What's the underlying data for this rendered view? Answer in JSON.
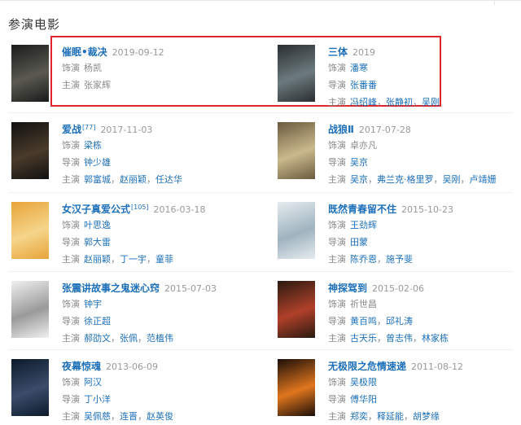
{
  "section": {
    "title": "参演电影"
  },
  "movies": [
    {
      "title": "催眠•裁决",
      "sup": "",
      "date": "2019-09-12",
      "rows": [
        {
          "label": "饰演",
          "values": [
            "杨凯"
          ],
          "linked": false
        },
        {
          "label": "主演",
          "values": [
            "张家辉"
          ],
          "linked": false
        }
      ],
      "poster_colors": [
        "#1a1a1a",
        "#5a5a52"
      ]
    },
    {
      "title": "三体",
      "sup": "",
      "date": "2019",
      "rows": [
        {
          "label": "饰演",
          "values": [
            "潘寒"
          ],
          "linked": true
        },
        {
          "label": "导演",
          "values": [
            "张番番"
          ],
          "linked": true
        },
        {
          "label": "主演",
          "values": [
            "冯绍峰",
            "张静初",
            "吴刚"
          ],
          "linked": true
        }
      ],
      "poster_colors": [
        "#2a2e30",
        "#6c7a7e"
      ]
    },
    {
      "title": "爱战",
      "sup": "[77]",
      "date": "2017-11-03",
      "rows": [
        {
          "label": "饰演",
          "values": [
            "梁栋"
          ],
          "linked": true
        },
        {
          "label": "导演",
          "values": [
            "钟少雄"
          ],
          "linked": true
        },
        {
          "label": "主演",
          "values": [
            "郭富城",
            "赵丽颖",
            "任达华"
          ],
          "linked": true
        }
      ],
      "poster_colors": [
        "#111111",
        "#4a3b2a"
      ]
    },
    {
      "title": "战狼Ⅱ",
      "sup": "",
      "date": "2017-07-28",
      "rows": [
        {
          "label": "饰演",
          "values": [
            "卓亦凡"
          ],
          "linked": false
        },
        {
          "label": "导演",
          "values": [
            "吴京"
          ],
          "linked": true
        },
        {
          "label": "主演",
          "values": [
            "吴京",
            "弗兰克·格里罗",
            "吴刚",
            "卢靖姗"
          ],
          "linked": true
        }
      ],
      "poster_colors": [
        "#6b5a3e",
        "#c9b98c"
      ]
    },
    {
      "title": "女汉子真爱公式",
      "sup": "[105]",
      "date": "2016-03-18",
      "rows": [
        {
          "label": "饰演",
          "values": [
            "叶思逸"
          ],
          "linked": true
        },
        {
          "label": "导演",
          "values": [
            "郭大雷"
          ],
          "linked": true
        },
        {
          "label": "主演",
          "values": [
            "赵丽颖",
            "丁一宇",
            "童菲"
          ],
          "linked": true
        }
      ],
      "poster_colors": [
        "#e8a33a",
        "#f5d58a"
      ]
    },
    {
      "title": "既然青春留不住",
      "sup": "",
      "date": "2015-10-23",
      "rows": [
        {
          "label": "饰演",
          "values": [
            "王劲辉"
          ],
          "linked": true
        },
        {
          "label": "导演",
          "values": [
            "田蒙"
          ],
          "linked": true
        },
        {
          "label": "主演",
          "values": [
            "陈乔恩",
            "施予斐"
          ],
          "linked": true
        }
      ],
      "poster_colors": [
        "#e6ecef",
        "#9fb3bf"
      ]
    },
    {
      "title": "张震讲故事之鬼迷心窍",
      "sup": "",
      "date": "2015-07-03",
      "rows": [
        {
          "label": "饰演",
          "values": [
            "钟宇"
          ],
          "linked": true
        },
        {
          "label": "导演",
          "values": [
            "徐正超"
          ],
          "linked": true
        },
        {
          "label": "主演",
          "values": [
            "郝劭文",
            "张佩",
            "范植伟"
          ],
          "linked": true
        }
      ],
      "poster_colors": [
        "#f0f0f0",
        "#9a9a9a"
      ]
    },
    {
      "title": "神探驾到",
      "sup": "",
      "date": "2015-02-06",
      "rows": [
        {
          "label": "饰演",
          "values": [
            "祈世昌"
          ],
          "linked": false
        },
        {
          "label": "导演",
          "values": [
            "黄百鸣",
            "邱礼涛"
          ],
          "linked": true
        },
        {
          "label": "主演",
          "values": [
            "古天乐",
            "曾志伟",
            "林家栋"
          ],
          "linked": true
        }
      ],
      "poster_colors": [
        "#2a1a10",
        "#b0402a"
      ]
    },
    {
      "title": "夜幕惊魂",
      "sup": "",
      "date": "2013-06-09",
      "rows": [
        {
          "label": "饰演",
          "values": [
            "阿汉"
          ],
          "linked": true
        },
        {
          "label": "导演",
          "values": [
            "丁小洋"
          ],
          "linked": true
        },
        {
          "label": "主演",
          "values": [
            "吴佩慈",
            "连晋",
            "赵英俊"
          ],
          "linked": true
        }
      ],
      "poster_colors": [
        "#0c1a2a",
        "#3a4c6a"
      ]
    },
    {
      "title": "无极限之危情速递",
      "sup": "",
      "date": "2011-08-12",
      "rows": [
        {
          "label": "饰演",
          "values": [
            "吴极限"
          ],
          "linked": true
        },
        {
          "label": "导演",
          "values": [
            "傅华阳"
          ],
          "linked": true
        },
        {
          "label": "主演",
          "values": [
            "郑奕",
            "释延能",
            "胡梦缘"
          ],
          "linked": true
        }
      ],
      "poster_colors": [
        "#1a0e08",
        "#e0761e"
      ]
    }
  ],
  "colors": {
    "link": "#1c6fb8",
    "highlight": "#e0262d"
  }
}
